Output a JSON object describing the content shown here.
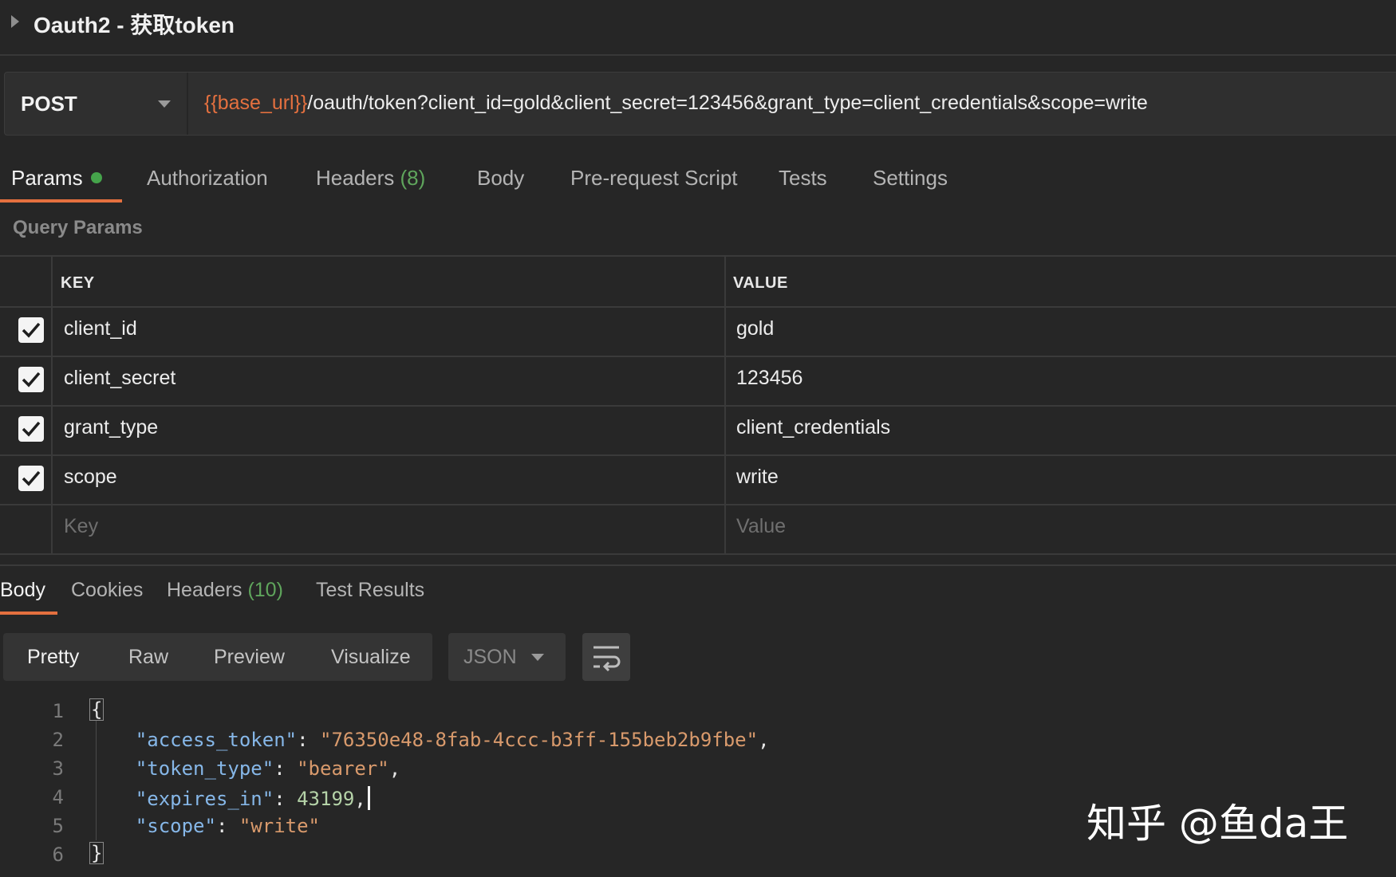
{
  "request": {
    "title": "Oauth2 - 获取token",
    "method": "POST",
    "url_variable": "{{base_url}}",
    "url_rest": "/oauth/token?client_id=gold&client_secret=123456&grant_type=client_credentials&scope=write"
  },
  "request_tabs": {
    "params": "Params",
    "authorization": "Authorization",
    "headers": "Headers",
    "headers_count": "(8)",
    "body": "Body",
    "pre_request_script": "Pre-request Script",
    "tests": "Tests",
    "settings": "Settings"
  },
  "query_params": {
    "title": "Query Params",
    "key_header": "KEY",
    "value_header": "VALUE",
    "rows": [
      {
        "key": "client_id",
        "value": "gold",
        "checked": true
      },
      {
        "key": "client_secret",
        "value": "123456",
        "checked": true
      },
      {
        "key": "grant_type",
        "value": "client_credentials",
        "checked": true
      },
      {
        "key": "scope",
        "value": "write",
        "checked": true
      }
    ],
    "key_placeholder": "Key",
    "value_placeholder": "Value"
  },
  "response_tabs": {
    "body": "Body",
    "cookies": "Cookies",
    "headers": "Headers",
    "headers_count": "(10)",
    "test_results": "Test Results"
  },
  "view": {
    "pretty": "Pretty",
    "raw": "Raw",
    "preview": "Preview",
    "visualize": "Visualize",
    "format": "JSON"
  },
  "response_body": {
    "line_numbers": [
      "1",
      "2",
      "3",
      "4",
      "5",
      "6"
    ],
    "open_brace": "{",
    "close_brace": "}",
    "access_token_key": "\"access_token\"",
    "access_token_value": "\"76350e48-8fab-4ccc-b3ff-155beb2b9fbe\"",
    "token_type_key": "\"token_type\"",
    "token_type_value": "\"bearer\"",
    "expires_in_key": "\"expires_in\"",
    "expires_in_value": "43199",
    "scope_key": "\"scope\"",
    "scope_value": "\"write\""
  },
  "watermark": "知乎 @鱼da王",
  "colors": {
    "accent": "#e4703f",
    "background": "#262626",
    "green": "#45a44b"
  }
}
